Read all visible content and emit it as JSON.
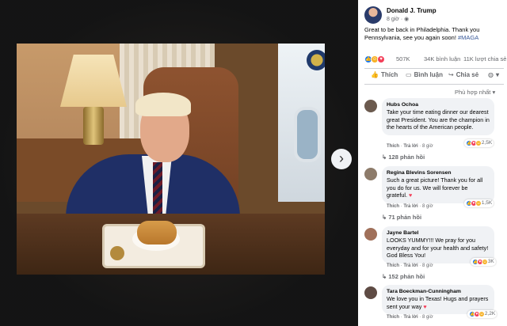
{
  "post": {
    "author": "Donald J. Trump",
    "time": "8 giờ",
    "privacy_icon": "globe-icon",
    "text_main": "Great to be back in Philadelphia. Thank you Pennsylvania, see you again soon!",
    "hashtag": "#MAGA"
  },
  "stats": {
    "reactions": "507K",
    "comments": "34K bình luận",
    "shares": "11K lượt chia sẻ"
  },
  "actions": {
    "like": "Thích",
    "comment": "Bình luận",
    "share": "Chia sẻ"
  },
  "sort_label": "Phù hợp nhất",
  "nav": {
    "next": "›"
  },
  "comments": [
    {
      "name": "Hubs Ochoa",
      "text": "Take your time eating dinner our dearest great President. You are the champion in the hearts of the American people.",
      "like": "Thích",
      "reply": "Trả lời",
      "time": "8 giờ",
      "reactions": "2,5K",
      "replies": "128 phản hồi"
    },
    {
      "name": "Regina Blevins Sorensen",
      "text": "Such a great picture! Thank you for all you do for us. We will forever be grateful.",
      "like": "Thích",
      "reply": "Trả lời",
      "time": "8 giờ",
      "reactions": "1,5K",
      "replies": "71 phản hồi"
    },
    {
      "name": "Jayne Bartel",
      "text": "LOOKS YUMMY!!! We pray for you everyday and for your health and safety! God Bless You!",
      "like": "Thích",
      "reply": "Trả lời",
      "time": "8 giờ",
      "reactions": "3K",
      "replies": "152 phản hồi"
    },
    {
      "name": "Tara Boeckman-Cunningham",
      "text": "We love you in Texas! Hugs and prayers sent your way",
      "like": "Thích",
      "reply": "Trả lời",
      "time": "8 giờ",
      "reactions": "2,2K"
    }
  ],
  "colors": {
    "like_blue": "#1877f2",
    "love_red": "#f33e58",
    "haha_yellow": "#f7b125",
    "hashtag_blue": "#385898"
  }
}
